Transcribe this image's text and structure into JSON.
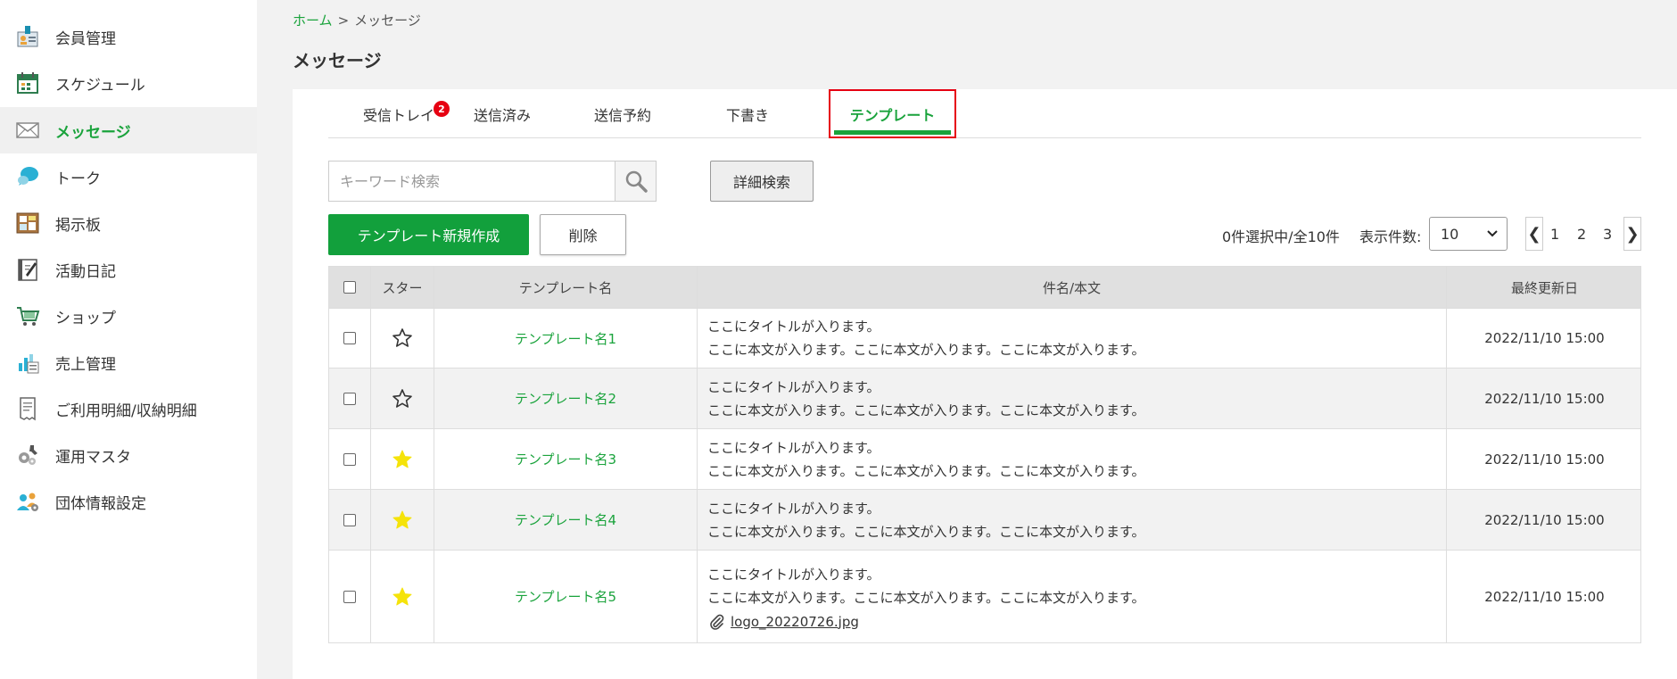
{
  "sidebar": {
    "items": [
      {
        "label": "会員管理",
        "icon": "member-management-icon"
      },
      {
        "label": "スケジュール",
        "icon": "calendar-icon"
      },
      {
        "label": "メッセージ",
        "icon": "envelope-icon",
        "active": true
      },
      {
        "label": "トーク",
        "icon": "chat-bubble-icon"
      },
      {
        "label": "掲示板",
        "icon": "bulletin-board-icon"
      },
      {
        "label": "活動日記",
        "icon": "diary-icon"
      },
      {
        "label": "ショップ",
        "icon": "shopping-cart-icon"
      },
      {
        "label": "売上管理",
        "icon": "sales-chart-icon"
      },
      {
        "label": "ご利用明細/収納明細",
        "icon": "receipt-icon"
      },
      {
        "label": "運用マスタ",
        "icon": "settings-tools-icon"
      },
      {
        "label": "団体情報設定",
        "icon": "group-settings-icon"
      }
    ]
  },
  "breadcrumb": {
    "home": "ホーム",
    "separator": ">",
    "current": "メッセージ"
  },
  "page": {
    "title": "メッセージ"
  },
  "tabs": [
    {
      "label": "受信トレイ",
      "badge": "2"
    },
    {
      "label": "送信済み"
    },
    {
      "label": "送信予約"
    },
    {
      "label": "下書き"
    },
    {
      "label": "テンプレート",
      "active": true
    }
  ],
  "search": {
    "placeholder": "キーワード検索",
    "value": "",
    "advanced_label": "詳細検索"
  },
  "actions": {
    "create_label": "テンプレート新規作成",
    "delete_label": "削除"
  },
  "list_info": {
    "count_text": "0件選択中/全10件",
    "per_page_label": "表示件数:",
    "per_page_value": "10"
  },
  "pagination": {
    "pages": [
      "1",
      "2",
      "3"
    ],
    "prev": "❮",
    "next": "❯"
  },
  "table": {
    "headers": {
      "star": "スター",
      "name": "テンプレート名",
      "body": "件名/本文",
      "updated": "最終更新日"
    },
    "rows": [
      {
        "name": "テンプレート名1",
        "starred": false,
        "subject": "ここにタイトルが入ります。",
        "body": "ここに本文が入ります。ここに本文が入ります。ここに本文が入ります。",
        "updated": "2022/11/10 15:00",
        "attachment": null
      },
      {
        "name": "テンプレート名2",
        "starred": false,
        "subject": "ここにタイトルが入ります。",
        "body": "ここに本文が入ります。ここに本文が入ります。ここに本文が入ります。",
        "updated": "2022/11/10 15:00",
        "attachment": null
      },
      {
        "name": "テンプレート名3",
        "starred": true,
        "subject": "ここにタイトルが入ります。",
        "body": "ここに本文が入ります。ここに本文が入ります。ここに本文が入ります。",
        "updated": "2022/11/10 15:00",
        "attachment": null
      },
      {
        "name": "テンプレート名4",
        "starred": true,
        "subject": "ここにタイトルが入ります。",
        "body": "ここに本文が入ります。ここに本文が入ります。ここに本文が入ります。",
        "updated": "2022/11/10 15:00",
        "attachment": null
      },
      {
        "name": "テンプレート名5",
        "starred": true,
        "subject": "ここにタイトルが入ります。",
        "body": "ここに本文が入ります。ここに本文が入ります。ここに本文が入ります。",
        "updated": "2022/11/10 15:00",
        "attachment": "logo_20220726.jpg"
      }
    ]
  },
  "colors": {
    "accent": "#1aa33c",
    "primary_button": "#12a03c",
    "badge": "#e60012",
    "highlight_border": "#e60012",
    "star_filled": "#f5e30a"
  }
}
